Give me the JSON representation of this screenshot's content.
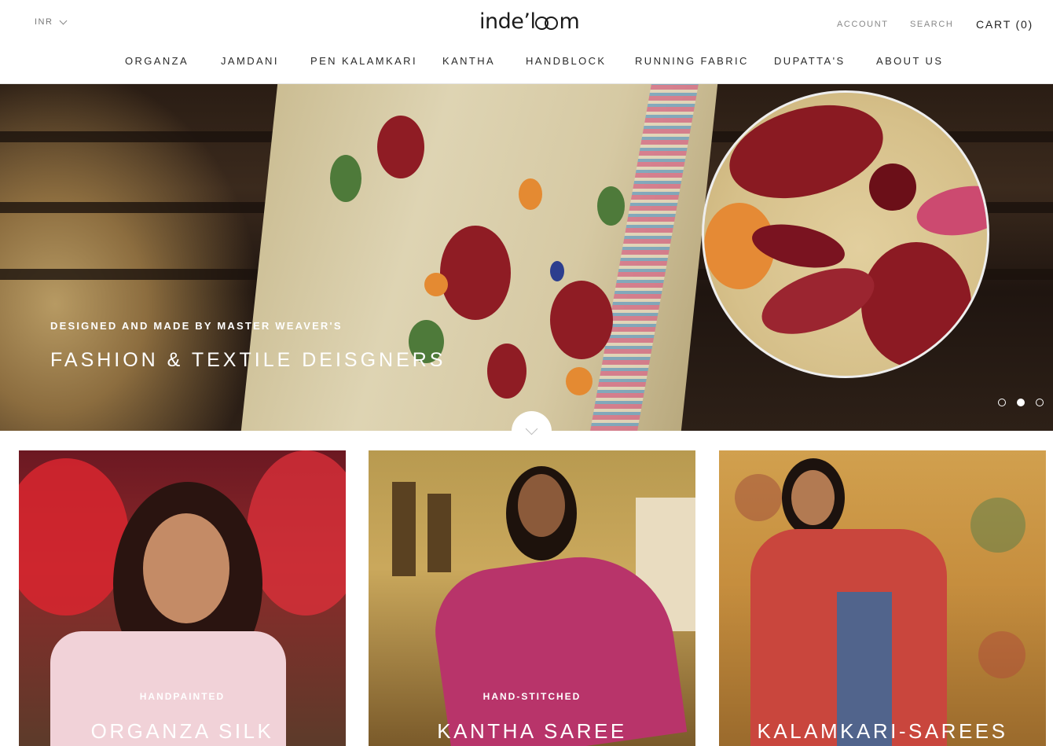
{
  "header": {
    "currency": "INR",
    "logo_text": [
      "inde",
      "’",
      "l",
      "m"
    ],
    "account": "ACCOUNT",
    "search": "SEARCH",
    "cart": "CART (0)"
  },
  "nav": {
    "items": [
      {
        "label": "ORGANZA"
      },
      {
        "label": "JAMDANI"
      },
      {
        "label": "PEN KALAMKARI"
      },
      {
        "label": "KANTHA"
      },
      {
        "label": "HANDBLOCK"
      },
      {
        "label": "RUNNING FABRIC"
      },
      {
        "label": "DUPATTA'S"
      },
      {
        "label": "ABOUT US"
      }
    ]
  },
  "hero": {
    "subtitle": "DESIGNED AND MADE BY MASTER WEAVER'S",
    "title": "FASHION & TEXTILE DEISGNERS",
    "slides": 3,
    "active_slide": 2
  },
  "collections": [
    {
      "subtitle": "HANDPAINTED",
      "title": "ORGANZA SILK"
    },
    {
      "subtitle": "HAND-STITCHED",
      "title": "KANTHA SAREE"
    },
    {
      "subtitle": "",
      "title": "KALAMKARI-SAREES"
    }
  ],
  "icons": {
    "currency_toggle": "chevron-down-icon",
    "scroll_down": "chevron-down-icon"
  }
}
